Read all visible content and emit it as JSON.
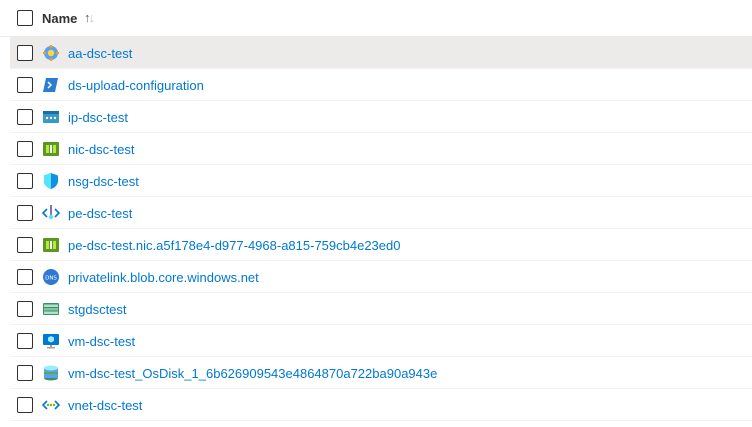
{
  "header": {
    "column_name": "Name",
    "sort_glyph_up": "↑",
    "sort_glyph_down": "↓"
  },
  "rows": [
    {
      "name": "aa-dsc-test",
      "icon": "automation-account-icon"
    },
    {
      "name": "ds-upload-configuration",
      "icon": "powershell-script-icon"
    },
    {
      "name": "ip-dsc-test",
      "icon": "public-ip-icon"
    },
    {
      "name": "nic-dsc-test",
      "icon": "network-interface-icon"
    },
    {
      "name": "nsg-dsc-test",
      "icon": "network-security-group-icon"
    },
    {
      "name": "pe-dsc-test",
      "icon": "private-endpoint-icon"
    },
    {
      "name": "pe-dsc-test.nic.a5f178e4-d977-4968-a815-759cb4e23ed0",
      "icon": "network-interface-icon"
    },
    {
      "name": "privatelink.blob.core.windows.net",
      "icon": "private-dns-zone-icon"
    },
    {
      "name": "stgdsctest",
      "icon": "storage-account-icon"
    },
    {
      "name": "vm-dsc-test",
      "icon": "virtual-machine-icon"
    },
    {
      "name": "vm-dsc-test_OsDisk_1_6b626909543e4864870a722ba90a943e",
      "icon": "disk-icon"
    },
    {
      "name": "vnet-dsc-test",
      "icon": "virtual-network-icon"
    }
  ],
  "dns_badge_text": "DNS"
}
